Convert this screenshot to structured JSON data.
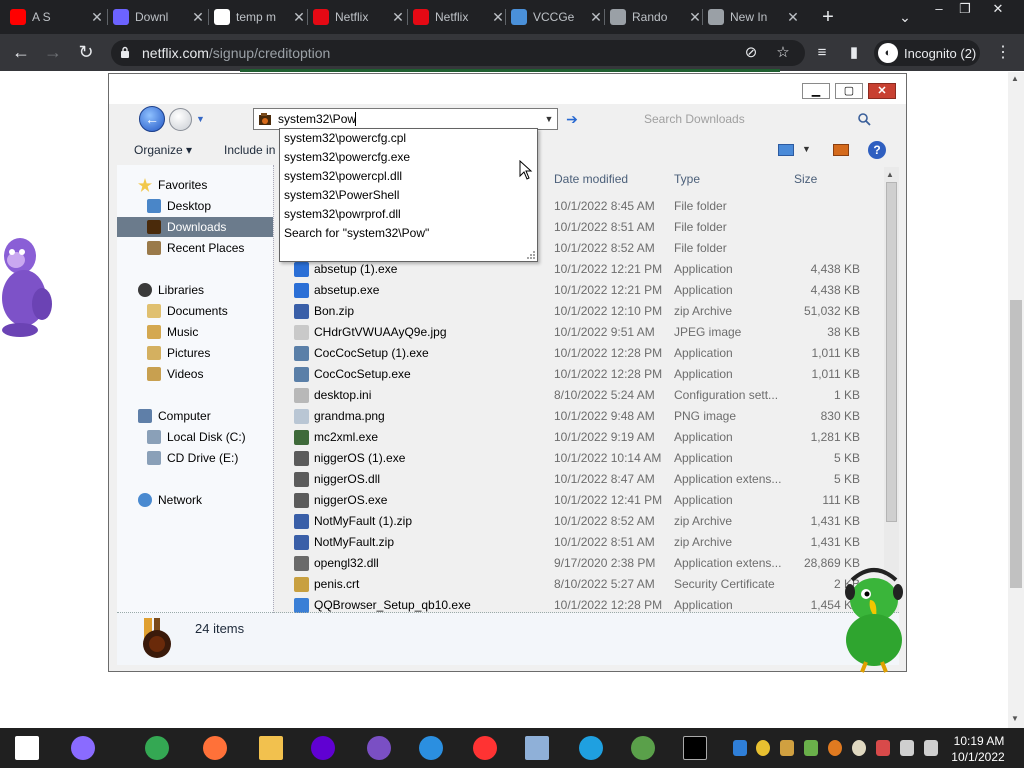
{
  "browser": {
    "tabs": [
      {
        "title": "A S",
        "favicon": "youtube-icon",
        "color": "#ff0000"
      },
      {
        "title": "Downl",
        "favicon": "document-icon",
        "color": "#6c63ff"
      },
      {
        "title": "temp m",
        "favicon": "google-icon",
        "color": "#ffffff"
      },
      {
        "title": "Netflix",
        "favicon": "netflix-icon",
        "color": "#e50914"
      },
      {
        "title": "Netflix",
        "favicon": "netflix-icon",
        "color": "#e50914"
      },
      {
        "title": "VCCGe",
        "favicon": "vccgen-icon",
        "color": "#4a90d9"
      },
      {
        "title": "Rando",
        "favicon": "gear-icon",
        "color": "#9aa0a6"
      },
      {
        "title": "New In",
        "favicon": "incognito-icon",
        "color": "#9aa0a6"
      }
    ],
    "url_domain": "netflix.com",
    "url_path": "/signup/creditoption",
    "incognito_label": "Incognito (2)"
  },
  "explorer": {
    "address_value": "system32\\Pow",
    "search_placeholder": "Search Downloads",
    "toolbar": {
      "organize": "Organize ▾",
      "include": "Include in"
    },
    "columns": {
      "date": "Date modified",
      "type": "Type",
      "size": "Size"
    },
    "nav": {
      "favorites": "Favorites",
      "desktop": "Desktop",
      "downloads": "Downloads",
      "recent": "Recent Places",
      "libraries": "Libraries",
      "documents": "Documents",
      "music": "Music",
      "pictures": "Pictures",
      "videos": "Videos",
      "computer": "Computer",
      "local_disk": "Local Disk (C:)",
      "cd_drive": "CD Drive (E:)",
      "network": "Network"
    },
    "autocomplete": [
      "system32\\powercfg.cpl",
      "system32\\powercfg.exe",
      "system32\\powercpl.dll",
      "system32\\PowerShell",
      "system32\\powrprof.dll",
      "Search for \"system32\\Pow\""
    ],
    "files": [
      {
        "name": "",
        "date": "10/1/2022 8:45 AM",
        "type": "File folder",
        "size": "",
        "icon": "folder-icon",
        "color": "#e8c66a"
      },
      {
        "name": "",
        "date": "10/1/2022 8:51 AM",
        "type": "File folder",
        "size": "",
        "icon": "folder-icon",
        "color": "#e8c66a"
      },
      {
        "name": "",
        "date": "10/1/2022 8:52 AM",
        "type": "File folder",
        "size": "",
        "icon": "folder-icon",
        "color": "#e8c66a"
      },
      {
        "name": "absetup (1).exe",
        "date": "10/1/2022 12:21 PM",
        "type": "Application",
        "size": "4,438 KB",
        "icon": "app-icon",
        "color": "#2b6fd6"
      },
      {
        "name": "absetup.exe",
        "date": "10/1/2022 12:21 PM",
        "type": "Application",
        "size": "4,438 KB",
        "icon": "app-icon",
        "color": "#2b6fd6"
      },
      {
        "name": "Bon.zip",
        "date": "10/1/2022 12:10 PM",
        "type": "zip Archive",
        "size": "51,032 KB",
        "icon": "zip-icon",
        "color": "#3a5fa8"
      },
      {
        "name": "CHdrGtVWUAAyQ9e.jpg",
        "date": "10/1/2022 9:51 AM",
        "type": "JPEG image",
        "size": "38 KB",
        "icon": "image-icon",
        "color": "#c9c9c9"
      },
      {
        "name": "CocCocSetup (1).exe",
        "date": "10/1/2022 12:28 PM",
        "type": "Application",
        "size": "1,011 KB",
        "icon": "coccoc-icon",
        "color": "#5a7fa8"
      },
      {
        "name": "CocCocSetup.exe",
        "date": "10/1/2022 12:28 PM",
        "type": "Application",
        "size": "1,011 KB",
        "icon": "coccoc-icon",
        "color": "#5a7fa8"
      },
      {
        "name": "desktop.ini",
        "date": "8/10/2022 5:24 AM",
        "type": "Configuration sett...",
        "size": "1 KB",
        "icon": "settings-file-icon",
        "color": "#b8b8b8"
      },
      {
        "name": "grandma.png",
        "date": "10/1/2022 9:48 AM",
        "type": "PNG image",
        "size": "830 KB",
        "icon": "image-icon",
        "color": "#b9c6d4"
      },
      {
        "name": "mc2xml.exe",
        "date": "10/1/2022 9:19 AM",
        "type": "Application",
        "size": "1,281 KB",
        "icon": "app-icon",
        "color": "#3f6a3a"
      },
      {
        "name": "niggerOS (1).exe",
        "date": "10/1/2022 10:14 AM",
        "type": "Application",
        "size": "5 KB",
        "icon": "app-icon",
        "color": "#5b5b5b"
      },
      {
        "name": "niggerOS.dll",
        "date": "10/1/2022 8:47 AM",
        "type": "Application extens...",
        "size": "5 KB",
        "icon": "dll-icon",
        "color": "#5b5b5b"
      },
      {
        "name": "niggerOS.exe",
        "date": "10/1/2022 12:41 PM",
        "type": "Application",
        "size": "111 KB",
        "icon": "app-icon",
        "color": "#5b5b5b"
      },
      {
        "name": "NotMyFault (1).zip",
        "date": "10/1/2022 8:52 AM",
        "type": "zip Archive",
        "size": "1,431 KB",
        "icon": "zip-icon",
        "color": "#3a5fa8"
      },
      {
        "name": "NotMyFault.zip",
        "date": "10/1/2022 8:51 AM",
        "type": "zip Archive",
        "size": "1,431 KB",
        "icon": "zip-icon",
        "color": "#3a5fa8"
      },
      {
        "name": "opengl32.dll",
        "date": "9/17/2020 2:38 PM",
        "type": "Application extens...",
        "size": "28,869 KB",
        "icon": "dll-icon",
        "color": "#6a6a6a"
      },
      {
        "name": "penis.crt",
        "date": "8/10/2022 5:27 AM",
        "type": "Security Certificate",
        "size": "2 KB",
        "icon": "certificate-icon",
        "color": "#c8a040"
      },
      {
        "name": "QQBrowser_Setup_qb10.exe",
        "date": "10/1/2022 12:28 PM",
        "type": "Application",
        "size": "1,454 KB",
        "icon": "app-icon",
        "color": "#3a7fd6"
      }
    ],
    "item_count": "24 items"
  },
  "taskbar": {
    "time": "10:19 AM",
    "date": "10/1/2022",
    "apps": [
      {
        "icon": "windows-start-icon",
        "color": "#ffffff"
      },
      {
        "icon": "cortana-icon",
        "color": "#8a6bff"
      },
      {
        "icon": "chrome-icon",
        "color": "#34a853"
      },
      {
        "icon": "firefox-icon",
        "color": "#ff7139"
      },
      {
        "icon": "file-explorer-icon",
        "color": "#f2c14e"
      },
      {
        "icon": "yahoo-icon",
        "color": "#6001d2"
      },
      {
        "icon": "bonzi-icon",
        "color": "#7a4fc4"
      },
      {
        "icon": "arrow-app-icon",
        "color": "#2b8fe0"
      },
      {
        "icon": "yandex-icon",
        "color": "#ff3333"
      },
      {
        "icon": "media-icon",
        "color": "#8fb0d8"
      },
      {
        "icon": "edge-icon",
        "color": "#1fa0e0"
      },
      {
        "icon": "cleaner-icon",
        "color": "#5aa04a"
      },
      {
        "icon": "cmd-icon",
        "color": "#000000"
      }
    ]
  }
}
